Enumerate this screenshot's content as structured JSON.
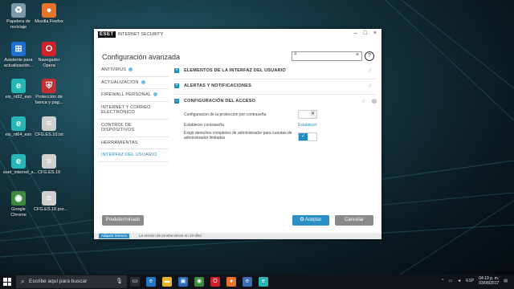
{
  "desktop": {
    "icons": [
      {
        "label": "Papelera de reciclaje",
        "icon": "recycle-bin-icon",
        "color": "#7d97ab"
      },
      {
        "label": "Mozilla Firefox",
        "icon": "firefox-icon",
        "color": "#e8742b"
      },
      {
        "label": "Asistente para actualización...",
        "icon": "windows-update-icon",
        "color": "#1e6fd1"
      },
      {
        "label": "Navegador Opera",
        "icon": "opera-icon",
        "color": "#d0222c"
      },
      {
        "label": "eis_nt32_esn",
        "icon": "eset-installer-icon",
        "color": "#26b6b6"
      },
      {
        "label": "Protección de banca y pag...",
        "icon": "banking-protection-icon",
        "color": "#c23131"
      },
      {
        "label": "eis_nt64_esn",
        "icon": "eset-installer-icon",
        "color": "#26b6b6"
      },
      {
        "label": "CFG.ES.10.txt",
        "icon": "config-file-icon",
        "color": "#cfcfcf"
      },
      {
        "label": "eset_internet_s...",
        "icon": "eset-installer-icon",
        "color": "#26b6b6"
      },
      {
        "label": "CFG.ES.10",
        "icon": "config-file-icon",
        "color": "#cfcfcf"
      },
      {
        "label": "Google Chrome",
        "icon": "chrome-icon",
        "color": "#3b8a3e"
      },
      {
        "label": "CFG.ES.10.por...",
        "icon": "config-file-icon",
        "color": "#cfcfcf"
      }
    ]
  },
  "window": {
    "brand_logo": "ESET",
    "product": "INTERNET SECURITY",
    "title": "Configuración avanzada",
    "search": {
      "value": "",
      "placeholder": ""
    },
    "help": "?",
    "controls": {
      "minimize": "–",
      "maximize": "□",
      "close": "×"
    },
    "sidebar": [
      {
        "label": "ANTIVIRUS",
        "info": true,
        "active": false
      },
      {
        "label": "ACTUALIZACIÓN",
        "info": true,
        "active": false
      },
      {
        "label": "FIREWALL PERSONAL",
        "info": true,
        "active": false
      },
      {
        "label": "INTERNET Y CORREO ELECTRÓNICO",
        "info": false,
        "active": false
      },
      {
        "label": "CONTROL DE DISPOSITIVOS",
        "info": false,
        "active": false
      },
      {
        "label": "HERRAMIENTAS",
        "info": false,
        "active": false
      },
      {
        "label": "INTERFAZ DEL USUARIO",
        "info": false,
        "active": true
      }
    ],
    "sections": [
      {
        "title": "ELEMENTOS DE LA INTERFAZ DEL USUARIO",
        "expanded": false
      },
      {
        "title": "ALERTAS Y NOTIFICACIONES",
        "expanded": false
      },
      {
        "title": "CONFIGURACIÓN DEL ACCESO",
        "expanded": true
      }
    ],
    "access_settings": [
      {
        "label": "Configuración de la protección por contraseña",
        "control": "toggle-off",
        "value": "✕"
      },
      {
        "label": "Establecer contraseña",
        "control": "link",
        "value": "Establecer"
      },
      {
        "label": "Exigir derechos completos de administrador para cuentas de administrador limitadas",
        "control": "toggle-on",
        "value": "✓"
      }
    ],
    "buttons": {
      "default": "Predeterminado",
      "accept": "Aceptar",
      "cancel": "Cancelar"
    },
    "status": {
      "license": "Adquirir licencia",
      "trial": "La versión de prueba vence en 29 días."
    }
  },
  "taskbar": {
    "search_text": "Escribe aquí para buscar",
    "apps": [
      {
        "icon": "task-view-icon",
        "color": "#2a2f35"
      },
      {
        "icon": "edge-icon",
        "color": "#1f78c8"
      },
      {
        "icon": "file-explorer-icon",
        "color": "#e8b62a"
      },
      {
        "icon": "store-icon",
        "color": "#2f6fb8"
      },
      {
        "icon": "chrome-icon",
        "color": "#3b8a3e"
      },
      {
        "icon": "opera-icon",
        "color": "#d0222c"
      },
      {
        "icon": "firefox-icon",
        "color": "#e8742b"
      },
      {
        "icon": "explorer-icon",
        "color": "#3d6fb7"
      },
      {
        "icon": "eset-icon",
        "color": "#26b6b6"
      }
    ],
    "language": "ESP",
    "time": "04:19 p. m.",
    "date": "03/08/2017"
  }
}
